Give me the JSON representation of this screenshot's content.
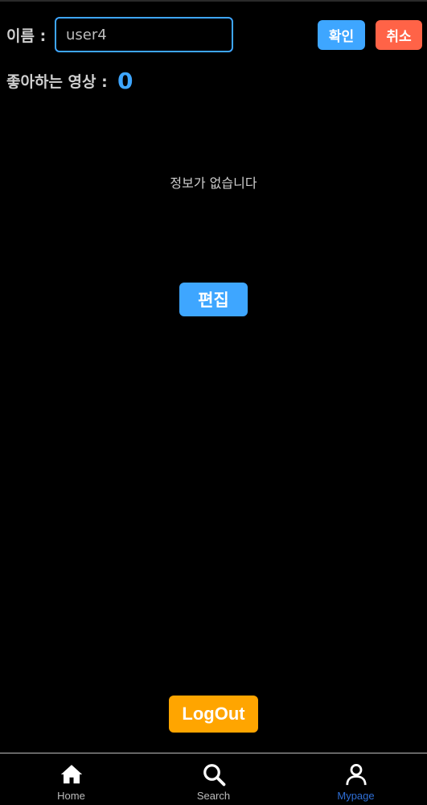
{
  "profile": {
    "name_label": "이름 :",
    "name_value": "user4",
    "confirm_label": "확인",
    "cancel_label": "취소",
    "liked_label": "좋아하는 영상 :",
    "liked_count": "0"
  },
  "main": {
    "empty_message": "정보가 없습니다",
    "edit_label": "편집",
    "logout_label": "LogOut"
  },
  "tabbar": {
    "items": [
      {
        "label": "Home",
        "icon": "home-icon",
        "active": false
      },
      {
        "label": "Search",
        "icon": "search-icon",
        "active": false
      },
      {
        "label": "Mypage",
        "icon": "person-icon",
        "active": true
      }
    ]
  },
  "colors": {
    "accent_blue": "#3ea6ff",
    "cancel_red": "#ff6347",
    "logout_orange": "#ffa500",
    "active_tab": "#2f6fd6",
    "background": "#000000"
  }
}
